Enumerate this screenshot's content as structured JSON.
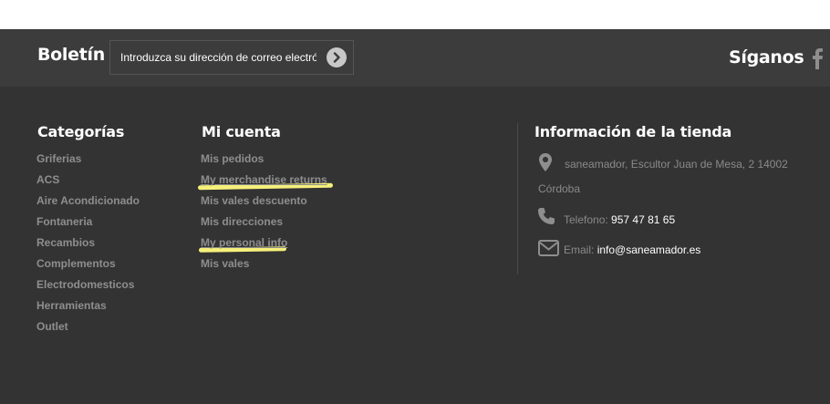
{
  "newsletter": {
    "title": "Boletín",
    "placeholder": "Introduzca su dirección de correo electrónico"
  },
  "social": {
    "title": "Síganos"
  },
  "categories": {
    "title": "Categorías",
    "items": [
      "Griferias",
      "ACS",
      "Aire Acondicionado",
      "Fontaneria",
      "Recambios",
      "Complementos",
      "Electrodomesticos",
      "Herramientas",
      "Outlet"
    ]
  },
  "account": {
    "title": "Mi cuenta",
    "items": [
      "Mis pedidos",
      "My merchandise returns",
      "Mis vales descuento",
      "Mis direcciones",
      "My personal info",
      "Mis vales"
    ]
  },
  "store": {
    "title": "Información de la tienda",
    "address_line1": "saneamador, Escultor Juan de Mesa, 2 14002",
    "address_line2": "Córdoba",
    "phone_label": "Telefono:",
    "phone": "957 47 81 65",
    "email_label": "Email:",
    "email": "info@saneamador.es"
  },
  "colors": {
    "highlight": "#f5f07a",
    "background": "#333333"
  }
}
